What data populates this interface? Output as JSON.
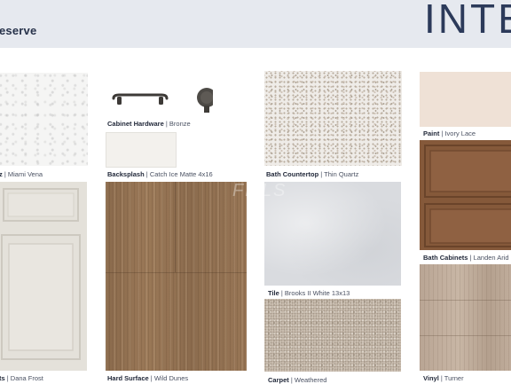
{
  "header": {
    "title": "eserve",
    "brand": "INTE"
  },
  "watermark": "FMLS",
  "swatches": {
    "countertop": {
      "category": "z",
      "name": "Miami Vena"
    },
    "hardware": {
      "category": "Cabinet Hardware",
      "name": "Bronze"
    },
    "backsplash": {
      "category": "Backsplash",
      "name": "Catch Ice Matte 4x16"
    },
    "bath_countertop": {
      "category": "Bath Countertop",
      "name": "Thin Quartz"
    },
    "paint": {
      "category": "Paint",
      "name": "Ivory Lace"
    },
    "cabinets": {
      "category": "ts",
      "name": "Dana Frost"
    },
    "hard_surface": {
      "category": "Hard Surface",
      "name": "Wild Dunes"
    },
    "tile": {
      "category": "Tile",
      "name": "Brooks II White 13x13"
    },
    "carpet": {
      "category": "Carpet",
      "name": "Weathered"
    },
    "bath_cabinets": {
      "category": "Bath Cabinets",
      "name": "Landen Arid"
    },
    "vinyl": {
      "category": "Vinyl",
      "name": "Turner"
    }
  },
  "colors": {
    "header_bg": "#e6e9ef",
    "brand_navy": "#2c3a5a",
    "paint_ivory_lace": "#efe1d6",
    "bronze": "#4a4642"
  }
}
